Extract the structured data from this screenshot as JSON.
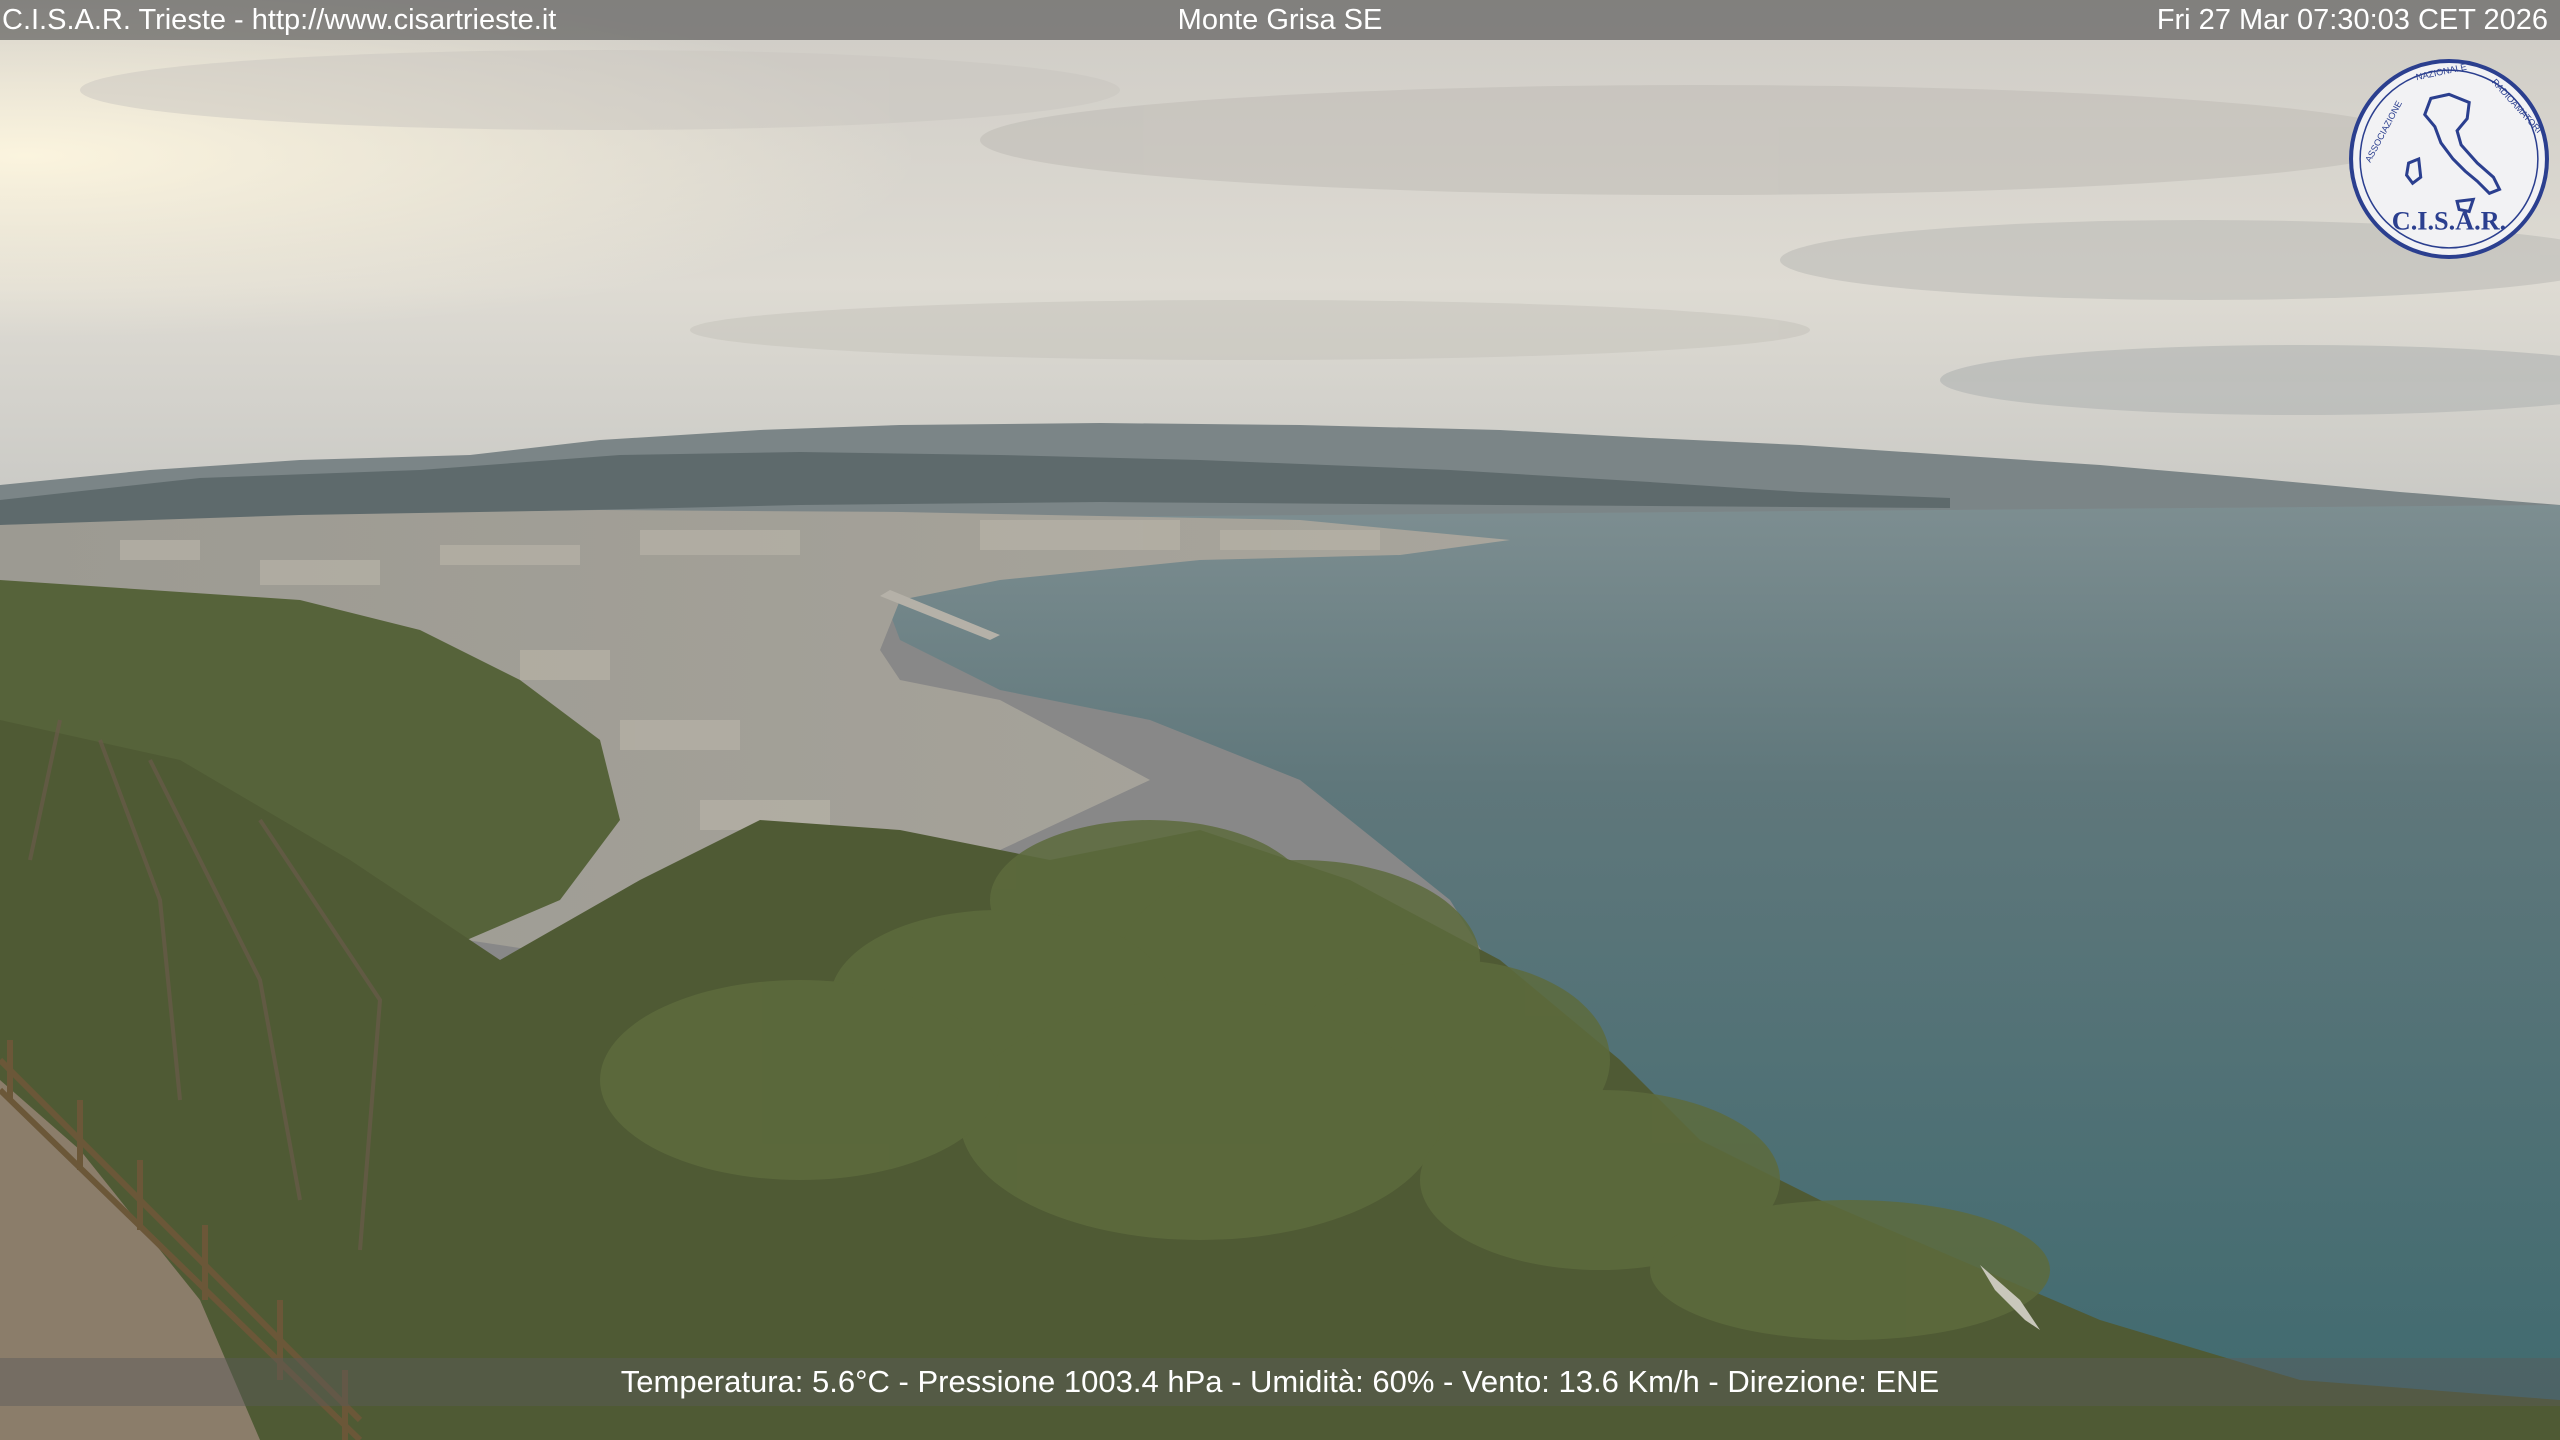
{
  "overlay": {
    "top_left": "C.I.S.A.R. Trieste - http://www.cisartrieste.it",
    "top_center": "Monte Grisa SE",
    "top_right": "Fri 27 Mar 07:30:03 CET 2026",
    "bottom": "Temperatura: 5.6°C - Pressione 1003.4 hPa - Umidità: 60% - Vento: 13.6 Km/h - Direzione: ENE"
  },
  "logo": {
    "arc_text": "ASSOCIAZIONE NAZIONALE RADIOAMATORI",
    "name": "C.I.S.A.R."
  },
  "colors": {
    "sky": "#d6d3cc",
    "sea": "#4f6b70",
    "hills": "#5c6a6c",
    "vegetation": "#56633a",
    "overlay_text": "#ffffff",
    "logo_blue": "#2b3f8f"
  }
}
